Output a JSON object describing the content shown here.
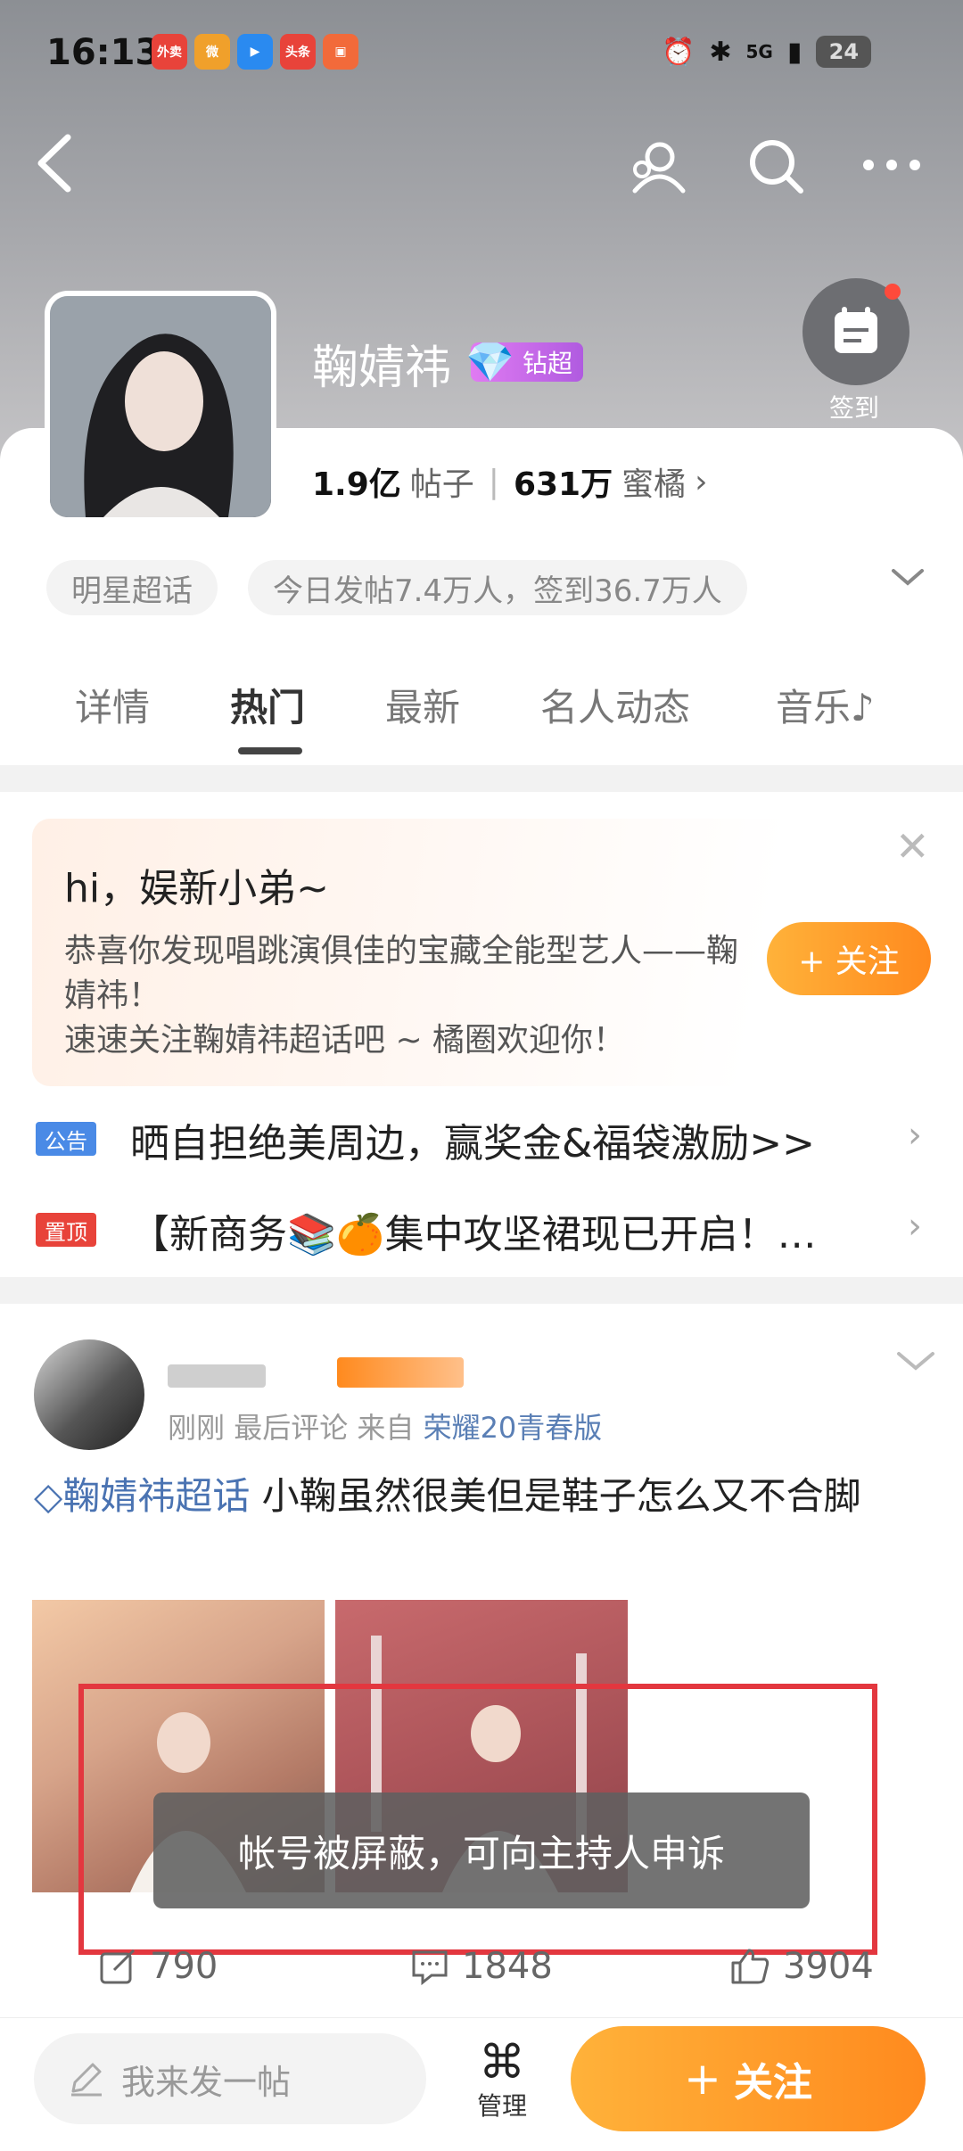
{
  "status_bar": {
    "time": "16:13",
    "apps": [
      {
        "name": "饿了么",
        "color": "#e8433a",
        "text": "外卖"
      },
      {
        "name": "weibo",
        "color": "#f0a02b",
        "text": "微"
      },
      {
        "name": "video",
        "color": "#2a8af0",
        "text": "▶"
      },
      {
        "name": "toutiao",
        "color": "#e8433a",
        "text": "头条"
      },
      {
        "name": "app5",
        "color": "#f26a3a",
        "text": "▣"
      }
    ],
    "network": "5G",
    "battery": "24"
  },
  "header": {
    "title": "鞠婧祎",
    "badge": "钻超",
    "sign_in_label": "签到",
    "posts_count": "1.9亿",
    "posts_label": "帖子",
    "fans_count": "631万",
    "fans_label": "蜜橘",
    "chips": [
      "明星超话",
      "今日发帖7.4万人，签到36.7万人"
    ]
  },
  "tabs": [
    {
      "label": "详情",
      "active": false
    },
    {
      "label": "热门",
      "active": true
    },
    {
      "label": "最新",
      "active": false
    },
    {
      "label": "名人动态",
      "active": false
    },
    {
      "label": "音乐♪",
      "active": false
    }
  ],
  "promo": {
    "greeting": "hi，娱新小弟~",
    "line1": "恭喜你发现唱跳演俱佳的宝藏全能型艺人——鞠婧祎！",
    "line2": "速速关注鞠婧祎超话吧 ~ 橘圈欢迎你！",
    "follow_label": "+ 关注"
  },
  "notices": [
    {
      "tag": "公告",
      "tag_color": "#4a8ae6",
      "text": "晒自担绝美周边，赢奖金&福袋激励>>"
    },
    {
      "tag": "置顶",
      "tag_color": "#e8433a",
      "text": "【新商务📚🍊集中攻坚裙现已开启！…"
    }
  ],
  "post": {
    "meta_time": "刚刚",
    "meta_last": "最后评论",
    "meta_from": "来自",
    "meta_device": "荣耀20青春版",
    "topic": "鞠婧祎超话",
    "text": " 小鞠虽然很美但是鞋子怎么又不合脚",
    "toast": "帐号被屏蔽，可向主持人申诉",
    "reposts": "790",
    "comments": "1848",
    "likes": "3904"
  },
  "bottom": {
    "input_placeholder": "我来发一帖",
    "manage_label": "管理",
    "follow_label": "关注"
  },
  "colors": {
    "accent_orange": "#ff8a1e",
    "topic_blue": "#4a73b2",
    "highlight_red": "#e3373f"
  }
}
